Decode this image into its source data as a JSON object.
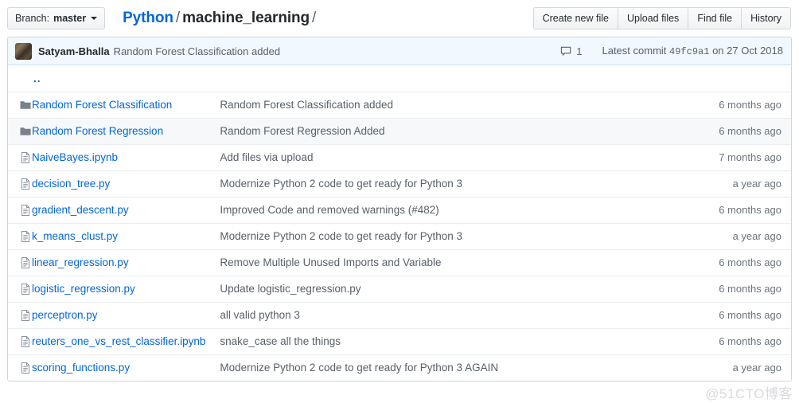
{
  "toolbar": {
    "branch": {
      "label": "Branch:",
      "value": "master",
      "caret_icon": "chevron-down-icon"
    },
    "breadcrumb": {
      "repo": "Python",
      "sep": "/",
      "path": "machine_learning",
      "trailing": "/"
    },
    "actions": [
      {
        "label": "Create new file"
      },
      {
        "label": "Upload files"
      },
      {
        "label": "Find file"
      },
      {
        "label": "History"
      }
    ]
  },
  "commit_bar": {
    "avatar_name": "avatar",
    "author": "Satyam-Bhalla",
    "message": "Random Forest Classification added",
    "comment_icon": "comment-icon",
    "comment_count": "1",
    "latest_commit_prefix": "Latest commit",
    "sha": "49fc9a1",
    "date_prefix": "on",
    "date": "27 Oct 2018"
  },
  "file_table": {
    "parent_dir": "..",
    "rows": [
      {
        "icon": "folder-icon",
        "name": "Random Forest Classification",
        "message": "Random Forest Classification added",
        "age": "6 months ago"
      },
      {
        "icon": "folder-icon",
        "name": "Random Forest Regression",
        "message": "Random Forest Regression Added",
        "age": "6 months ago"
      },
      {
        "icon": "file-icon",
        "name": "NaiveBayes.ipynb",
        "message": "Add files via upload",
        "age": "7 months ago"
      },
      {
        "icon": "file-icon",
        "name": "decision_tree.py",
        "message": "Modernize Python 2 code to get ready for Python 3",
        "age": "a year ago"
      },
      {
        "icon": "file-icon",
        "name": "gradient_descent.py",
        "message": "Improved Code and removed warnings (#482)",
        "age": "6 months ago"
      },
      {
        "icon": "file-icon",
        "name": "k_means_clust.py",
        "message": "Modernize Python 2 code to get ready for Python 3",
        "age": "a year ago"
      },
      {
        "icon": "file-icon",
        "name": "linear_regression.py",
        "message": "Remove Multiple Unused Imports and Variable",
        "age": "6 months ago"
      },
      {
        "icon": "file-icon",
        "name": "logistic_regression.py",
        "message": "Update logistic_regression.py",
        "age": "6 months ago"
      },
      {
        "icon": "file-icon",
        "name": "perceptron.py",
        "message": "all valid python 3",
        "age": "6 months ago"
      },
      {
        "icon": "file-icon",
        "name": "reuters_one_vs_rest_classifier.ipynb",
        "message": "snake_case all the things",
        "age": "6 months ago"
      },
      {
        "icon": "file-icon",
        "name": "scoring_functions.py",
        "message": "Modernize Python 2 code to get ready for Python 3 AGAIN",
        "age": "a year ago"
      }
    ]
  },
  "watermark": "@51CTO博客",
  "colors": {
    "link": "#0366d6",
    "text": "#24292e",
    "muted": "#586069",
    "commit_bg": "#f1f8ff",
    "commit_border": "#c8e1ff",
    "row_alt": "#f6f8fa",
    "border": "#d1d5da"
  }
}
